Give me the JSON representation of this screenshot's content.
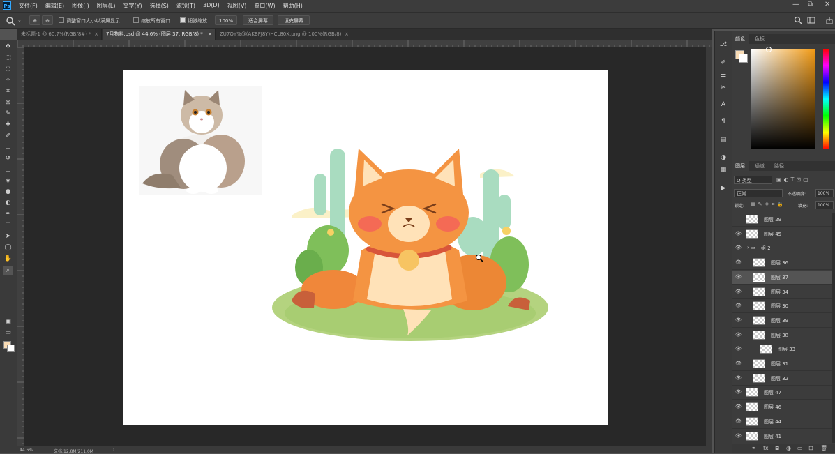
{
  "app": {
    "logo": "Ps"
  },
  "menu": [
    "文件(F)",
    "编辑(E)",
    "图像(I)",
    "图层(L)",
    "文字(Y)",
    "选择(S)",
    "滤镜(T)",
    "3D(D)",
    "视图(V)",
    "窗口(W)",
    "帮助(H)"
  ],
  "window_controls": {
    "minimize": "—",
    "restore": "⧉",
    "close": "✕"
  },
  "options_bar": {
    "tool_icon": "magnifier-icon",
    "check1": "调整窗口大小以满屏显示",
    "check2": "缩放所有窗口",
    "check3": "细微缩放",
    "zoom_value": "100%",
    "fit_screen": "适合屏幕",
    "fill_screen": "填充屏幕"
  },
  "tabs": [
    {
      "label": "未标题-1 @ 60.7%(RGB/8#) *"
    },
    {
      "label": "7月物料.psd @ 44.6% (图层 37, RGB/8) *"
    },
    {
      "label": "ZU7QY%@(AKBFJ8Y)HCL80X.png @ 100%(RGB/8)"
    }
  ],
  "tab_close": "×",
  "status": {
    "zoom": "44.6%",
    "doc": "文档:12.8M/211.0M",
    "arrow": "›"
  },
  "colors": {
    "foreground": "#f9dcb5",
    "background": "#ffffff",
    "accent": "#31a8ff"
  },
  "panels": {
    "color_tabs": [
      "颜色",
      "色板"
    ],
    "layer_tabs": [
      "图层",
      "通道",
      "路径"
    ],
    "filter_kind": "Q 类型",
    "blend_mode": "正常",
    "opacity_label": "不透明度:",
    "opacity_value": "100%",
    "lock_label": "锁定:",
    "fill_label": "填充:",
    "fill_value": "100%"
  },
  "layers": [
    {
      "name": "图层 29",
      "visible": false,
      "indent": 0,
      "selected": false
    },
    {
      "name": "图层 45",
      "visible": true,
      "indent": 0,
      "selected": false
    },
    {
      "name": "组 2",
      "visible": true,
      "indent": 0,
      "selected": false,
      "group": true
    },
    {
      "name": "图层 36",
      "visible": true,
      "indent": 1,
      "selected": false
    },
    {
      "name": "图层 37",
      "visible": true,
      "indent": 1,
      "selected": true
    },
    {
      "name": "图层 34",
      "visible": true,
      "indent": 1,
      "selected": false
    },
    {
      "name": "图层 30",
      "visible": true,
      "indent": 1,
      "selected": false
    },
    {
      "name": "图层 39",
      "visible": true,
      "indent": 1,
      "selected": false
    },
    {
      "name": "图层 38",
      "visible": true,
      "indent": 1,
      "selected": false
    },
    {
      "name": "图层 33",
      "visible": true,
      "indent": 2,
      "selected": false
    },
    {
      "name": "图层 31",
      "visible": true,
      "indent": 1,
      "selected": false
    },
    {
      "name": "图层 32",
      "visible": true,
      "indent": 1,
      "selected": false
    },
    {
      "name": "图层 47",
      "visible": true,
      "indent": 0,
      "selected": false
    },
    {
      "name": "图层 46",
      "visible": true,
      "indent": 0,
      "selected": false
    },
    {
      "name": "图层 44",
      "visible": true,
      "indent": 0,
      "selected": false
    },
    {
      "name": "图层 41",
      "visible": true,
      "indent": 0,
      "selected": false
    }
  ]
}
